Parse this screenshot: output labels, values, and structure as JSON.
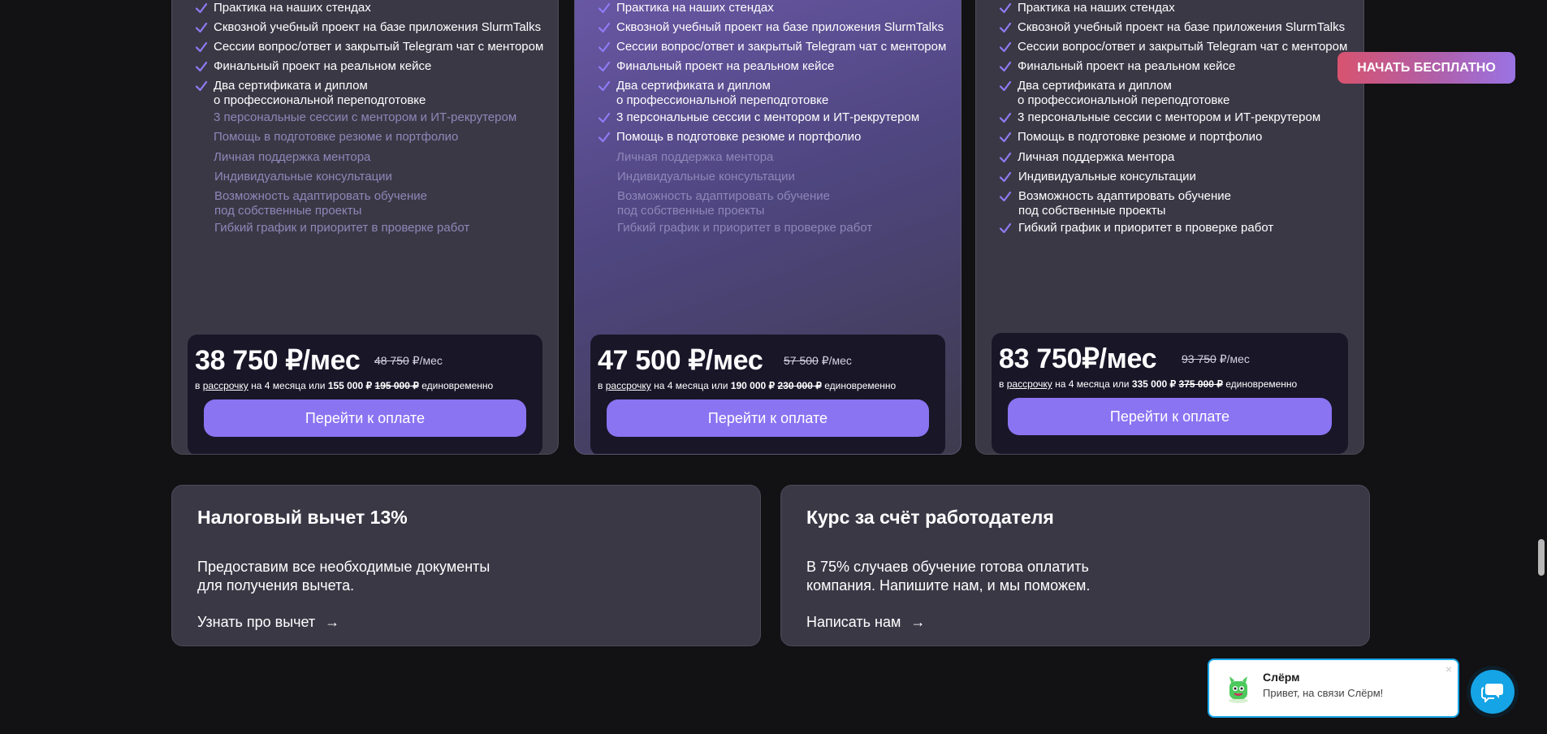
{
  "plans": [
    {
      "features": [
        {
          "text": "Практика на наших стендах",
          "on": true
        },
        {
          "text": "Сквозной учебный проект на базе приложения SlurmTalks",
          "on": true
        },
        {
          "text": "Сессии вопрос/ответ и закрытый Telegram чат с ментором",
          "on": true
        },
        {
          "text": "Финальный проект на реальном кейсе",
          "on": true
        },
        {
          "text": "Два сертификата и диплом\nо профессиональной переподготовке",
          "on": true
        },
        {
          "text": "3 персональные сессии с ментором и ИТ-рекрутером",
          "on": false
        },
        {
          "text": "Помощь в подготовке резюме и портфолио",
          "on": false
        },
        {
          "text": "Личная поддержка ментора",
          "on": false
        },
        {
          "text": "Индивидуальные консультации",
          "on": false
        },
        {
          "text": "Возможность адаптировать обучение\nпод собственные проекты",
          "on": false
        },
        {
          "text": "Гибкий график и приоритет в проверке работ",
          "on": false
        }
      ],
      "price": "38 750 ₽/мес",
      "old_price": "48 750",
      "old_suffix": " ₽/мес",
      "inst_pre": "в ",
      "inst_link": "рассрочку",
      "inst_mid": " на 4 месяца или ",
      "inst_total": "155 000 ₽",
      "inst_total_old": "195 000 ₽",
      "inst_post": " единовременно",
      "button": "Перейти к оплате"
    },
    {
      "features": [
        {
          "text": "Практика на наших стендах",
          "on": true
        },
        {
          "text": "Сквозной учебный проект на базе приложения SlurmTalks",
          "on": true
        },
        {
          "text": "Сессии вопрос/ответ и закрытый Telegram чат с ментором",
          "on": true
        },
        {
          "text": "Финальный проект на реальном кейсе",
          "on": true
        },
        {
          "text": "Два сертификата и диплом\nо профессиональной переподготовке",
          "on": true
        },
        {
          "text": "3 персональные сессии с ментором и ИТ-рекрутером",
          "on": true
        },
        {
          "text": "Помощь в подготовке резюме и портфолио",
          "on": true
        },
        {
          "text": "Личная поддержка ментора",
          "on": false
        },
        {
          "text": "Индивидуальные консультации",
          "on": false
        },
        {
          "text": "Возможность адаптировать обучение\nпод собственные проекты",
          "on": false
        },
        {
          "text": "Гибкий график и приоритет в проверке работ",
          "on": false
        }
      ],
      "price": "47 500 ₽/мес",
      "old_price": "57 500",
      "old_suffix": " ₽/мес",
      "inst_pre": "в ",
      "inst_link": "рассрочку",
      "inst_mid": " на 4 месяца или ",
      "inst_total": "190 000 ₽",
      "inst_total_old": "230 000 ₽",
      "inst_post": " единовременно",
      "button": "Перейти к оплате"
    },
    {
      "features": [
        {
          "text": "Практика на наших стендах",
          "on": true
        },
        {
          "text": "Сквозной учебный проект на базе приложения SlurmTalks",
          "on": true
        },
        {
          "text": "Сессии вопрос/ответ и закрытый Telegram чат с ментором",
          "on": true
        },
        {
          "text": "Финальный проект на реальном кейсе",
          "on": true
        },
        {
          "text": "Два сертификата и диплом\nо профессиональной переподготовке",
          "on": true
        },
        {
          "text": "3 персональные сессии с ментором и ИТ-рекрутером",
          "on": true
        },
        {
          "text": "Помощь в подготовке резюме и портфолио",
          "on": true
        },
        {
          "text": "Личная поддержка ментора",
          "on": true
        },
        {
          "text": "Индивидуальные консультации",
          "on": true
        },
        {
          "text": "Возможность адаптировать обучение\nпод собственные проекты",
          "on": true
        },
        {
          "text": "Гибкий график и приоритет в проверке работ",
          "on": true
        }
      ],
      "price": "83 750₽/мес",
      "old_price": "93 750",
      "old_suffix": " ₽/мес",
      "inst_pre": "в ",
      "inst_link": "рассрочку",
      "inst_mid": " на 4 месяца или ",
      "inst_total": "335 000 ₽",
      "inst_total_old": "375 000 ₽",
      "inst_post": " единовременно",
      "button": "Перейти к оплате"
    }
  ],
  "tax_card": {
    "title": "Налоговый вычет 13%",
    "text": "Предоставим все необходимые документы\nдля получения вычета.",
    "link": "Узнать про вычет",
    "arrow": "→"
  },
  "employer_card": {
    "title": "Курс за счёт работодателя",
    "text": "В 75% случаев обучение готова оплатить\nкомпания. Напишите нам, и мы поможем.",
    "link": "Написать нам",
    "arrow": "→"
  },
  "cta": {
    "label": "НАЧАТЬ БЕСПЛАТНО"
  },
  "chat": {
    "name": "Слёрм",
    "message": "Привет, на связи Слёрм!",
    "close": "×"
  },
  "colors": {
    "accent": "#8b74f2",
    "check": "#8f7cf5",
    "chat_blue": "#15a4e6"
  },
  "icons": {
    "check": "check-icon",
    "arrow": "arrow-right-icon",
    "chat": "chat-bubble-icon",
    "avatar": "mascot-avatar-icon"
  }
}
